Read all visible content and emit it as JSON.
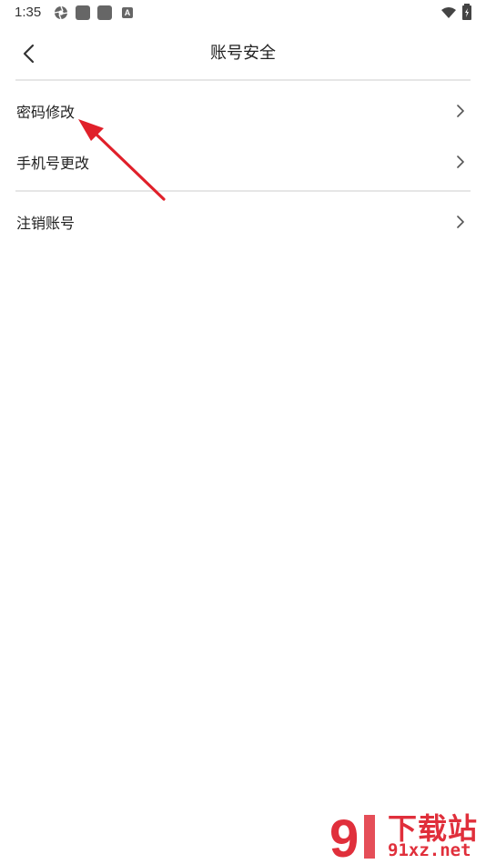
{
  "status_bar": {
    "time": "1:35",
    "icons": [
      "aperture-icon",
      "app-icon",
      "app-icon",
      "a-badge-icon",
      "wifi-icon",
      "battery-icon"
    ],
    "badge_letter": "A"
  },
  "header": {
    "title": "账号安全",
    "back_icon": "chevron-left-icon"
  },
  "menu": {
    "items": [
      {
        "label": "密码修改",
        "icon": "chevron-right-icon"
      },
      {
        "label": "手机号更改",
        "icon": "chevron-right-icon"
      },
      {
        "label": "注销账号",
        "icon": "chevron-right-icon"
      }
    ]
  },
  "annotation": {
    "arrow_color": "#e0202a"
  },
  "watermark": {
    "logo_text": "9",
    "title": "下载站",
    "url": "91xz.net",
    "color": "#e02f3b"
  }
}
